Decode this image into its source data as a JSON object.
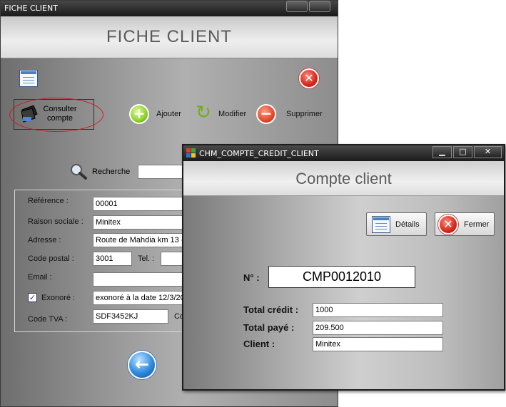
{
  "main_window": {
    "title": "FICHE CLIENT",
    "header": "FICHE CLIENT",
    "toolbar": {
      "consulter_label": "Consulter compte",
      "ajouter_label": "Ajouter",
      "modifier_label": "Modifier",
      "supprimer_label": "Supprimer"
    },
    "search": {
      "label": "Recherche",
      "value": ""
    },
    "form": {
      "reference_label": "Référence :",
      "reference_value": "00001",
      "raison_label": "Raison sociale :",
      "raison_value": "Minitex",
      "adresse_label": "Adresse :",
      "adresse_value": "Route de Mahdia km 13 -",
      "code_postal_label": "Code postal :",
      "code_postal_value": "3001",
      "tel_label": "Tel. :",
      "tel_value": "",
      "email_label": "Email :",
      "email_value": "",
      "exonore_label": "Exonoré :",
      "exonore_checked": true,
      "exonore_value": "exonoré à la date 12/3/20",
      "code_tva_label": "Code TVA :",
      "code_tva_value": "SDF3452KJ",
      "co_label": "Co"
    }
  },
  "dialog": {
    "title": "CHM_COMPTE_CREDIT_CLIENT",
    "header": "Compte client",
    "details_label": "Détails",
    "fermer_label": "Fermer",
    "numero_label": "N° :",
    "numero_value": "CMP0012010",
    "total_credit_label": "Total crédit :",
    "total_credit_value": "1000",
    "total_paye_label": "Total payé :",
    "total_paye_value": "209.500",
    "client_label": "Client :",
    "client_value": "Minitex"
  },
  "colors": {
    "highlight_oval": "#d41a1a",
    "title_bar": "#1a1a1a"
  }
}
